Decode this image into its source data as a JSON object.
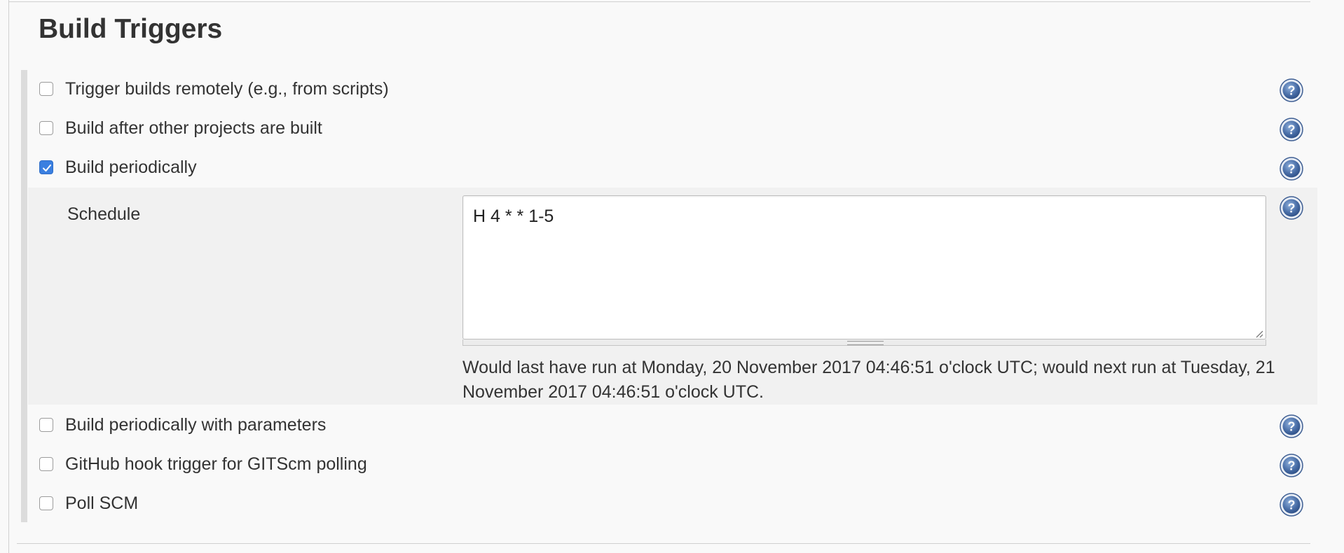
{
  "section": {
    "title": "Build Triggers"
  },
  "options": [
    {
      "label": "Trigger builds remotely (e.g., from scripts)",
      "checked": false
    },
    {
      "label": "Build after other projects are built",
      "checked": false
    },
    {
      "label": "Build periodically",
      "checked": true
    },
    {
      "label": "Build periodically with parameters",
      "checked": false
    },
    {
      "label": "GitHub hook trigger for GITScm polling",
      "checked": false
    },
    {
      "label": "Poll SCM",
      "checked": false
    }
  ],
  "schedule": {
    "label": "Schedule",
    "value": "H 4 * * 1-5",
    "info": "Would last have run at Monday, 20 November 2017 04:46:51 o'clock UTC; would next run at Tuesday, 21 November 2017 04:46:51 o'clock UTC."
  },
  "icons": {
    "help": "help-icon",
    "check": "checkmark-icon",
    "resize": "resize-handle-icon"
  },
  "colors": {
    "checkbox_checked": "#3a7fe0",
    "help_icon": "#4a6fa8"
  }
}
